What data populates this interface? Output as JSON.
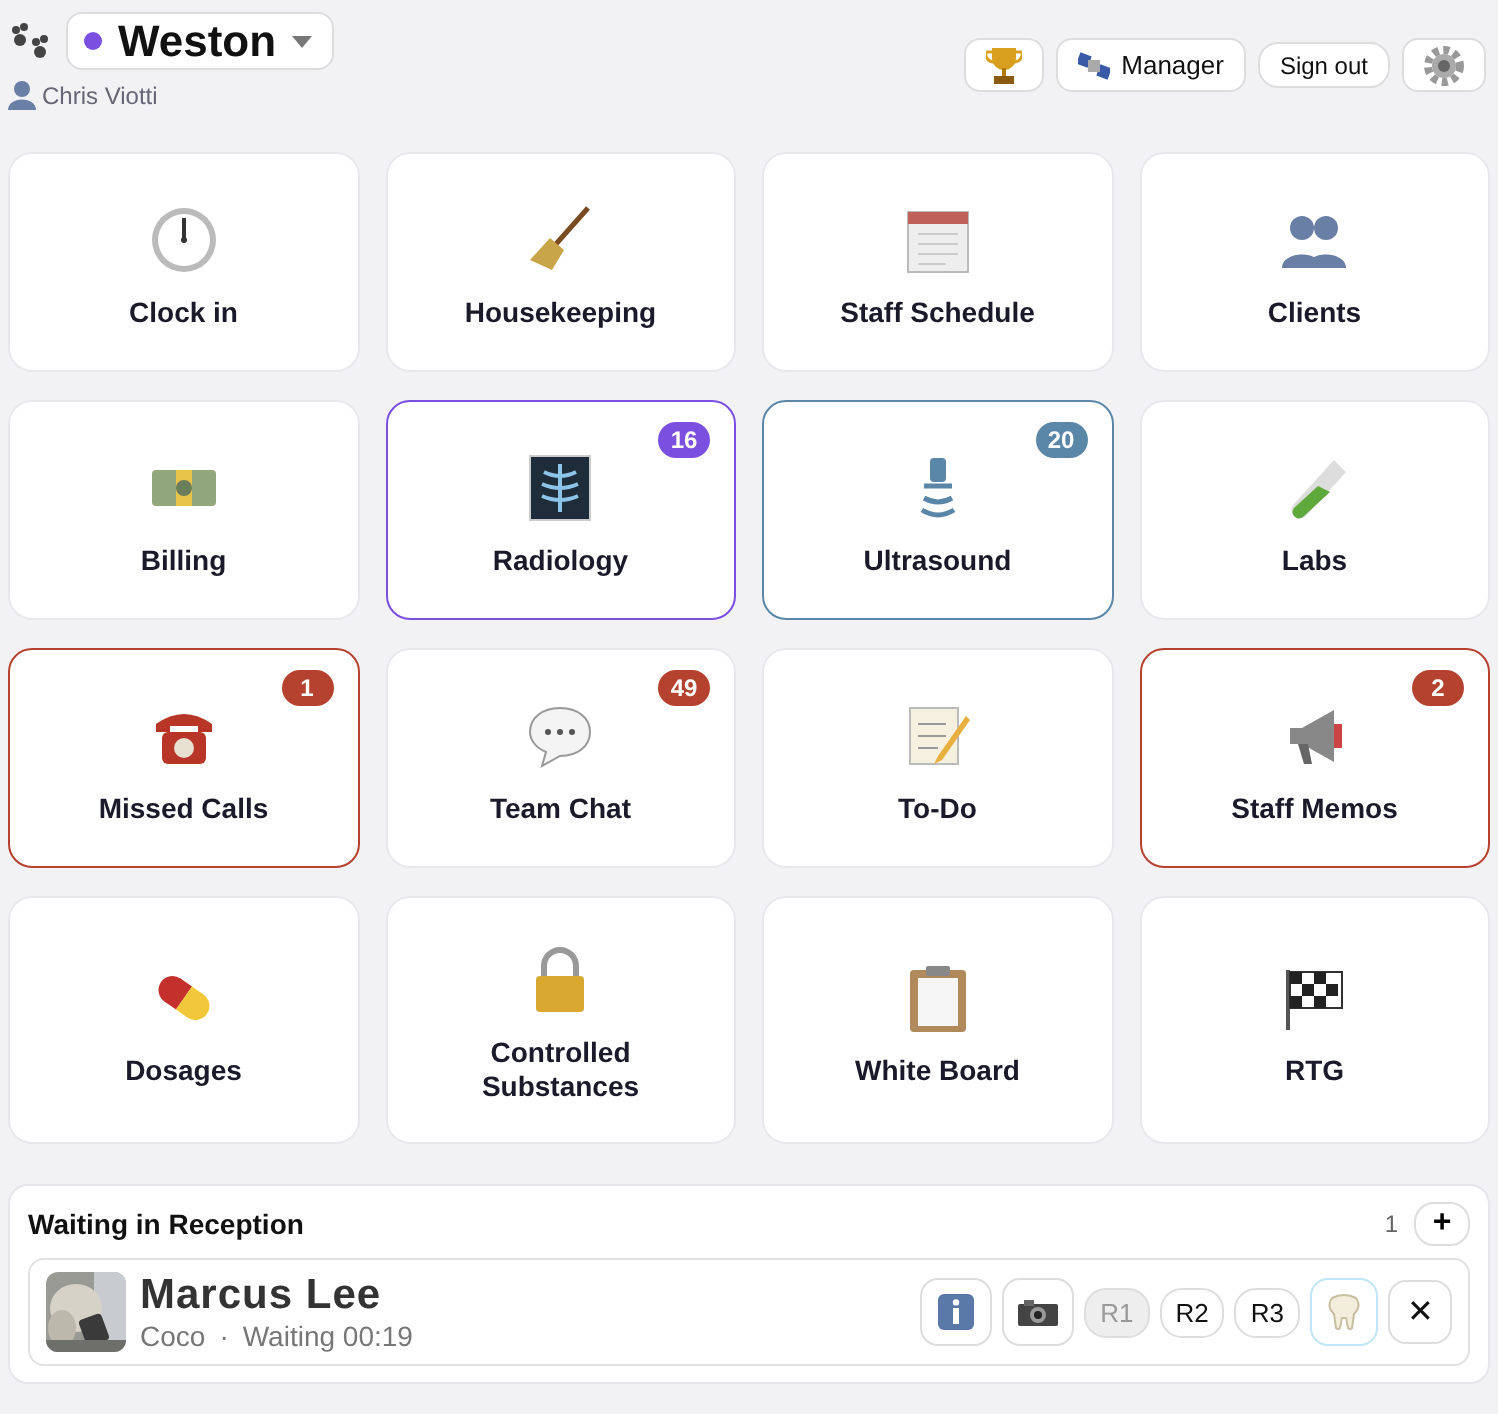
{
  "header": {
    "location": {
      "name": "Weston",
      "color": "#7b4fe0"
    },
    "user": "Chris Viotti",
    "buttons": [
      {
        "kind": "trophy"
      },
      {
        "kind": "manager",
        "label": "Manager"
      },
      {
        "kind": "text",
        "label": "Sign out"
      },
      {
        "kind": "gear"
      }
    ]
  },
  "tiles": [
    {
      "label": "Clock in"
    },
    {
      "label": "Housekeeping"
    },
    {
      "label": "Staff Schedule"
    },
    {
      "label": "Clients"
    },
    {
      "label": "Billing"
    },
    {
      "label": "Radiology",
      "badge": "16",
      "color": "#7b4fe0"
    },
    {
      "label": "Ultrasound",
      "badge": "20",
      "color": "#5a87a8"
    },
    {
      "label": "Labs"
    },
    {
      "label": "Missed Calls",
      "badge": "1",
      "color": "#b5412f"
    },
    {
      "label": "Team Chat",
      "badge": "49",
      "color": "#b5412f",
      "outlined": false
    },
    {
      "label": "To-Do"
    },
    {
      "label": "Staff Memos",
      "badge": "2",
      "color": "#b5412f"
    },
    {
      "label": "Dosages"
    },
    {
      "label": "Controlled Substances"
    },
    {
      "label": "White Board"
    },
    {
      "label": "RTG"
    }
  ],
  "reception": {
    "title": "Waiting in Reception",
    "count": "1",
    "add_button": "+",
    "patients": [
      {
        "name": "Marcus Lee",
        "pet": "Coco",
        "separator": "·",
        "status": "Waiting 00:19",
        "actions": [
          {
            "kind": "info"
          },
          {
            "kind": "camera"
          },
          {
            "kind": "room",
            "label": "R1",
            "disabled": true
          },
          {
            "kind": "room",
            "label": "R2",
            "disabled": false
          },
          {
            "kind": "room",
            "label": "R3",
            "disabled": false
          },
          {
            "kind": "dental"
          },
          {
            "kind": "close",
            "label": "✕"
          }
        ]
      }
    ]
  }
}
